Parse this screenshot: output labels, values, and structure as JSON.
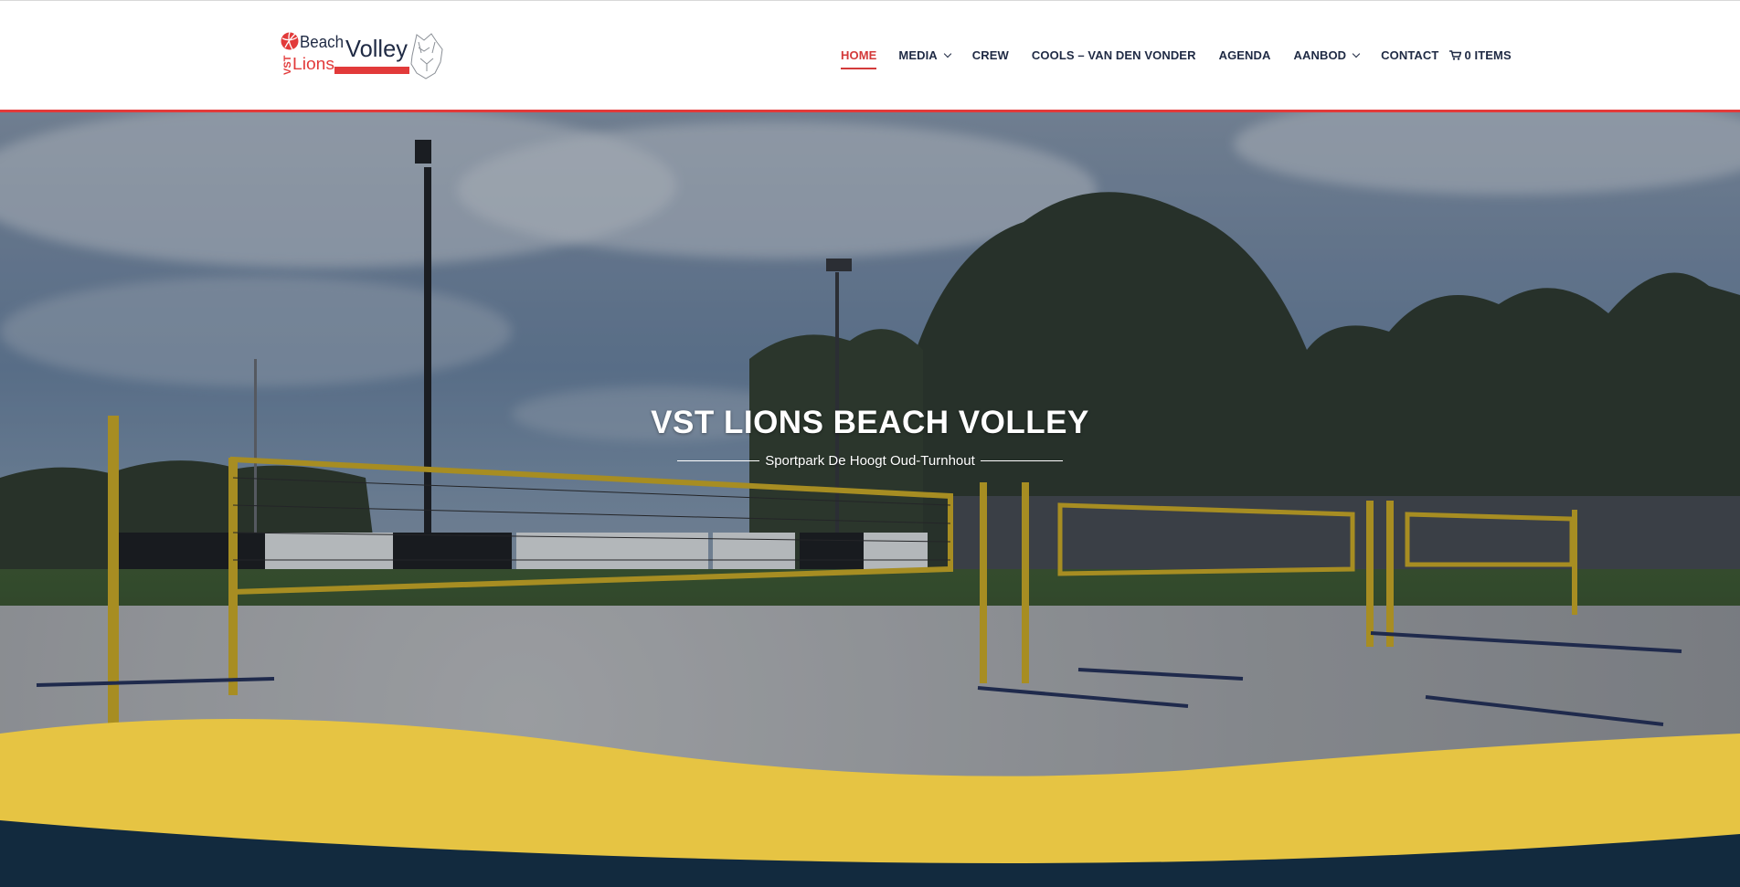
{
  "brand": {
    "logo_word_vst": "VST",
    "logo_word_beach": "Beach",
    "logo_word_lions": "Lions",
    "logo_word_volley": "Volley",
    "accent_red": "#e23a3a",
    "navy": "#1f2a44",
    "yellow": "#e6c443",
    "dark_blue": "#122a3e"
  },
  "nav": {
    "items": [
      {
        "label": "HOME",
        "active": true,
        "has_dropdown": false
      },
      {
        "label": "MEDIA",
        "active": false,
        "has_dropdown": true
      },
      {
        "label": "CREW",
        "active": false,
        "has_dropdown": false
      },
      {
        "label": "COOLS – VAN DEN VONDER",
        "active": false,
        "has_dropdown": false
      },
      {
        "label": "AGENDA",
        "active": false,
        "has_dropdown": false
      },
      {
        "label": "AANBOD",
        "active": false,
        "has_dropdown": true
      },
      {
        "label": "CONTACT",
        "active": false,
        "has_dropdown": false
      }
    ],
    "cart_label": "0 ITEMS",
    "cart_icon": "cart-icon"
  },
  "hero": {
    "title": "VST LIONS BEACH VOLLEY",
    "subtitle": "Sportpark De Hoogt Oud-Turnhout"
  }
}
